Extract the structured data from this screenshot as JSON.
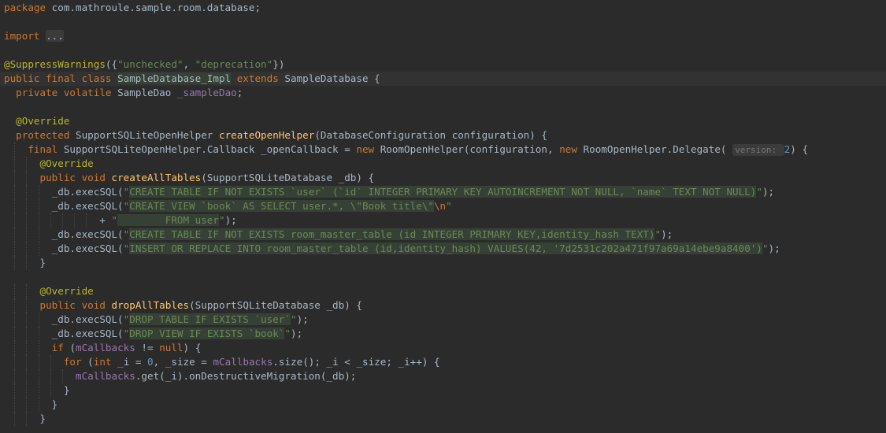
{
  "editor": {
    "language": "java",
    "lines": [
      [
        [
          "k",
          "package "
        ],
        [
          "t",
          "com.mathroule.sample.room.database;"
        ]
      ],
      [],
      [
        [
          "k",
          "import "
        ],
        [
          "fold",
          "..."
        ]
      ],
      [],
      [
        [
          "a",
          "@SuppressWarnings"
        ],
        [
          "t",
          "({"
        ],
        [
          "s",
          "\"unchecked\""
        ],
        [
          "t",
          ", "
        ],
        [
          "s",
          "\"deprecation\""
        ],
        [
          "t",
          "})"
        ]
      ],
      [
        [
          "k",
          "public final class "
        ],
        [
          "cls",
          "SampleDatabase_Impl"
        ],
        [
          "t",
          " "
        ],
        [
          "k",
          "extends "
        ],
        [
          "t",
          "SampleDatabase {"
        ]
      ],
      [
        [
          "t",
          "  "
        ],
        [
          "k",
          "private volatile "
        ],
        [
          "t",
          "SampleDao "
        ],
        [
          "p",
          "_sampleDao"
        ],
        [
          "t",
          ";"
        ]
      ],
      [],
      [
        [
          "t",
          "  "
        ],
        [
          "a",
          "@Override"
        ]
      ],
      [
        [
          "t",
          "  "
        ],
        [
          "k",
          "protected "
        ],
        [
          "t",
          "SupportSQLiteOpenHelper "
        ],
        [
          "f",
          "createOpenHelper"
        ],
        [
          "t",
          "(DatabaseConfiguration configuration) {"
        ]
      ],
      [
        [
          "t",
          "    "
        ],
        [
          "k",
          "final "
        ],
        [
          "t",
          "SupportSQLiteOpenHelper.Callback _openCallback = "
        ],
        [
          "k",
          "new "
        ],
        [
          "t",
          "RoomOpenHelper(configuration, "
        ],
        [
          "k",
          "new "
        ],
        [
          "t",
          "RoomOpenHelper.Delegate( "
        ],
        [
          "hint",
          "version: "
        ],
        [
          "n",
          "2"
        ],
        [
          "t",
          ") {"
        ]
      ],
      [
        [
          "t",
          "      "
        ],
        [
          "a",
          "@Override"
        ]
      ],
      [
        [
          "t",
          "      "
        ],
        [
          "k",
          "public void "
        ],
        [
          "f",
          "createAllTables"
        ],
        [
          "t",
          "(SupportSQLiteDatabase _db) {"
        ]
      ],
      [
        [
          "t",
          "        _db.execSQL("
        ],
        [
          "s",
          "\""
        ],
        [
          "hls",
          "CREATE TABLE IF NOT EXISTS `user` (`id` INTEGER PRIMARY KEY AUTOINCREMENT NOT NULL, `name` TEXT NOT NULL)"
        ],
        [
          "s",
          "\""
        ],
        [
          "t",
          ");"
        ]
      ],
      [
        [
          "t",
          "        _db.execSQL("
        ],
        [
          "s",
          "\""
        ],
        [
          "hls",
          "CREATE VIEW `book` AS SELECT user.*, \\\"Book title\\\""
        ],
        [
          "k",
          "\\n"
        ],
        [
          "s",
          "\""
        ]
      ],
      [
        [
          "t",
          "                + "
        ],
        [
          "s",
          "\""
        ],
        [
          "hls",
          "        FROM user"
        ],
        [
          "s",
          "\""
        ],
        [
          "t",
          ");"
        ]
      ],
      [
        [
          "t",
          "        _db.execSQL("
        ],
        [
          "s",
          "\""
        ],
        [
          "hls",
          "CREATE TABLE IF NOT EXISTS room_master_table (id INTEGER PRIMARY KEY,identity_hash TEXT)"
        ],
        [
          "s",
          "\""
        ],
        [
          "t",
          ");"
        ]
      ],
      [
        [
          "t",
          "        _db.execSQL("
        ],
        [
          "s",
          "\""
        ],
        [
          "hls",
          "INSERT OR REPLACE INTO room_master_table (id,identity_hash) VALUES(42, '7d2531c202a471f97a69a14ebe9a8400')"
        ],
        [
          "s",
          "\""
        ],
        [
          "t",
          ");"
        ]
      ],
      [
        [
          "t",
          "      }"
        ]
      ],
      [],
      [
        [
          "t",
          "      "
        ],
        [
          "a",
          "@Override"
        ]
      ],
      [
        [
          "t",
          "      "
        ],
        [
          "k",
          "public void "
        ],
        [
          "f",
          "dropAllTables"
        ],
        [
          "t",
          "(SupportSQLiteDatabase _db) {"
        ]
      ],
      [
        [
          "t",
          "        _db.execSQL("
        ],
        [
          "s",
          "\""
        ],
        [
          "hls",
          "DROP TABLE IF EXISTS `user`"
        ],
        [
          "s",
          "\""
        ],
        [
          "t",
          ");"
        ]
      ],
      [
        [
          "t",
          "        _db.execSQL("
        ],
        [
          "s",
          "\""
        ],
        [
          "hls",
          "DROP VIEW IF EXISTS `book`"
        ],
        [
          "s",
          "\""
        ],
        [
          "t",
          ");"
        ]
      ],
      [
        [
          "t",
          "        "
        ],
        [
          "k",
          "if "
        ],
        [
          "t",
          "("
        ],
        [
          "p",
          "mCallbacks"
        ],
        [
          "t",
          " != "
        ],
        [
          "k",
          "null"
        ],
        [
          "t",
          ") {"
        ]
      ],
      [
        [
          "t",
          "          "
        ],
        [
          "k",
          "for "
        ],
        [
          "t",
          "("
        ],
        [
          "k",
          "int "
        ],
        [
          "t",
          "_i = "
        ],
        [
          "n",
          "0"
        ],
        [
          "t",
          ", _size = "
        ],
        [
          "p",
          "mCallbacks"
        ],
        [
          "t",
          ".size(); _i < _size; _i++) {"
        ]
      ],
      [
        [
          "t",
          "            "
        ],
        [
          "p",
          "mCallbacks"
        ],
        [
          "t",
          ".get(_i).onDestructiveMigration(_db);"
        ]
      ],
      [
        [
          "t",
          "          }"
        ]
      ],
      [
        [
          "t",
          "        }"
        ]
      ],
      [
        [
          "t",
          "      }"
        ]
      ]
    ]
  }
}
